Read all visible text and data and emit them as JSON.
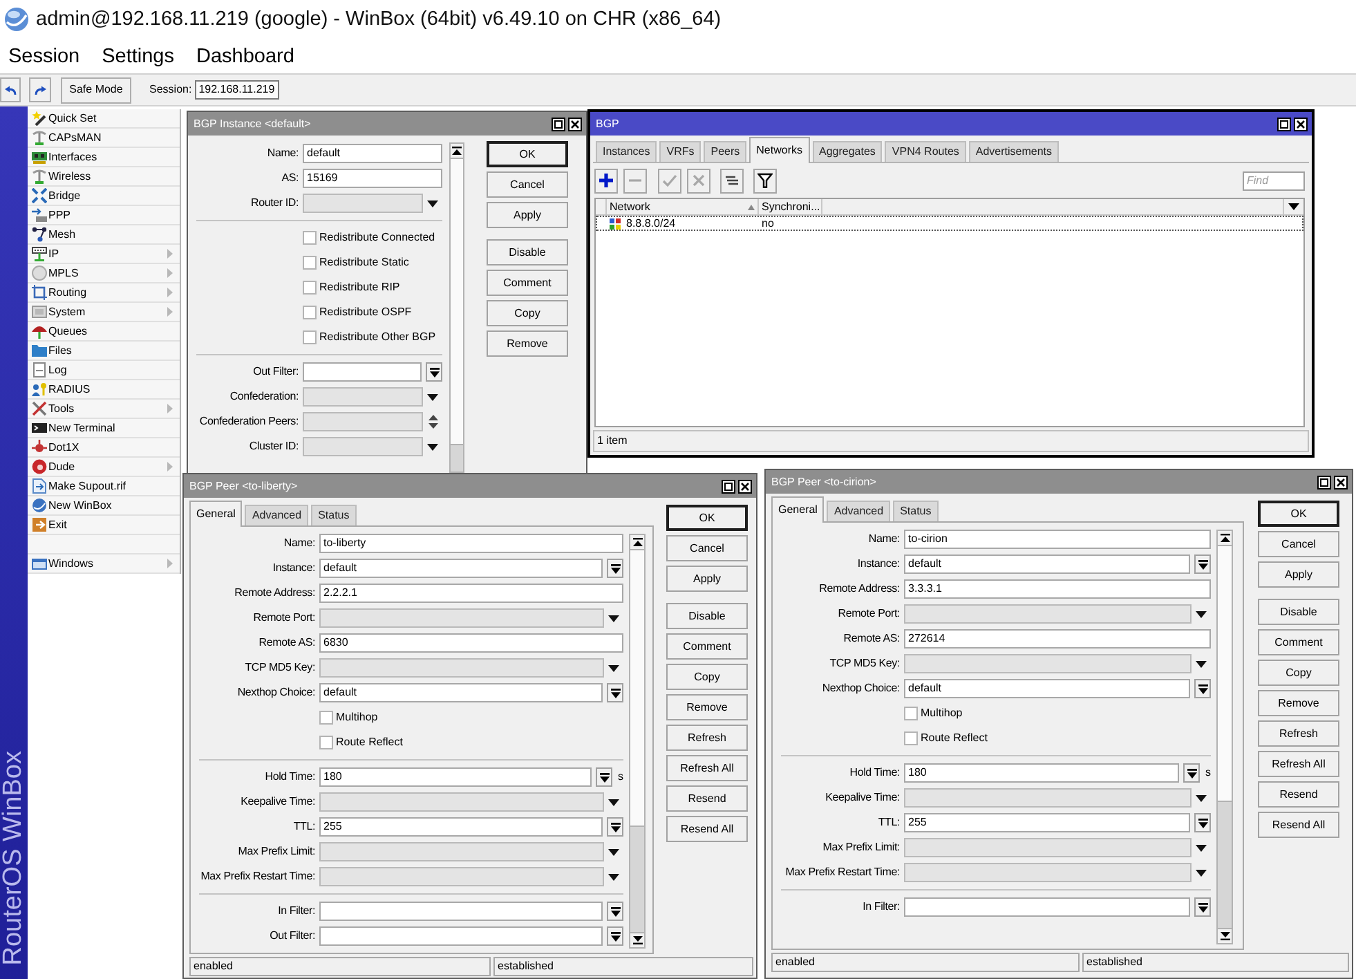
{
  "window": {
    "title": "admin@192.168.11.219 (google) - WinBox (64bit) v6.49.10 on CHR (x86_64)"
  },
  "menu_bar": [
    "Session",
    "Settings",
    "Dashboard"
  ],
  "toolbar": {
    "safe_mode": {
      "label": "Safe Mode",
      "on": false
    },
    "session_label": "Session:",
    "session_value": "192.168.11.219"
  },
  "sidebar": {
    "brand": "RouterOS WinBox",
    "items": [
      {
        "label": "Quick Set",
        "submenu": false
      },
      {
        "label": "CAPsMAN",
        "submenu": false
      },
      {
        "label": "Interfaces",
        "submenu": false
      },
      {
        "label": "Wireless",
        "submenu": false
      },
      {
        "label": "Bridge",
        "submenu": false
      },
      {
        "label": "PPP",
        "submenu": false
      },
      {
        "label": "Mesh",
        "submenu": false
      },
      {
        "label": "IP",
        "submenu": true
      },
      {
        "label": "MPLS",
        "submenu": true
      },
      {
        "label": "Routing",
        "submenu": true
      },
      {
        "label": "System",
        "submenu": true
      },
      {
        "label": "Queues",
        "submenu": false
      },
      {
        "label": "Files",
        "submenu": false
      },
      {
        "label": "Log",
        "submenu": false
      },
      {
        "label": "RADIUS",
        "submenu": false
      },
      {
        "label": "Tools",
        "submenu": true
      },
      {
        "label": "New Terminal",
        "submenu": false
      },
      {
        "label": "Dot1X",
        "submenu": false
      },
      {
        "label": "Dude",
        "submenu": true
      },
      {
        "label": "Make Supout.rif",
        "submenu": false
      },
      {
        "label": "New WinBox",
        "submenu": false
      },
      {
        "label": "Exit",
        "submenu": false
      }
    ],
    "footer_items": [
      {
        "label": "Windows",
        "submenu": true
      }
    ]
  },
  "windows": [
    {
      "kind": "form",
      "title": "BGP Instance <default>",
      "active": false,
      "form": [
        {
          "kind": "text",
          "label": "Name:",
          "value": "default"
        },
        {
          "kind": "text",
          "label": "AS:",
          "value": "15169"
        },
        {
          "kind": "unset",
          "label": "Router ID:"
        },
        {
          "kind": "separator"
        },
        {
          "kind": "checkbox",
          "label": "Redistribute Connected",
          "checked": false
        },
        {
          "kind": "checkbox",
          "label": "Redistribute Static",
          "checked": false
        },
        {
          "kind": "checkbox",
          "label": "Redistribute RIP",
          "checked": false
        },
        {
          "kind": "checkbox",
          "label": "Redistribute OSPF",
          "checked": false
        },
        {
          "kind": "checkbox",
          "label": "Redistribute Other BGP",
          "checked": false
        },
        {
          "kind": "separator"
        },
        {
          "kind": "dropdown",
          "label": "Out Filter:"
        },
        {
          "kind": "unset",
          "label": "Confederation:"
        },
        {
          "kind": "spinner",
          "label": "Confederation Peers:"
        },
        {
          "kind": "unset",
          "label": "Cluster ID:"
        }
      ],
      "button_groups": [
        [
          {
            "label": "OK",
            "default": true
          },
          {
            "label": "Cancel",
            "default": false
          },
          {
            "label": "Apply",
            "default": false
          }
        ],
        [
          {
            "label": "Disable",
            "default": false
          },
          {
            "label": "Comment",
            "default": false
          },
          {
            "label": "Copy",
            "default": false
          },
          {
            "label": "Remove",
            "default": false
          }
        ]
      ]
    },
    {
      "kind": "list",
      "title": "BGP",
      "active": true,
      "tabs": [
        {
          "label": "Instances",
          "selected": false
        },
        {
          "label": "VRFs",
          "selected": false
        },
        {
          "label": "Peers",
          "selected": false
        },
        {
          "label": "Networks",
          "selected": true
        },
        {
          "label": "Aggregates",
          "selected": false
        },
        {
          "label": "VPN4 Routes",
          "selected": false
        },
        {
          "label": "Advertisements",
          "selected": false
        }
      ],
      "toolbar": [
        {
          "kind": "add",
          "disabled": false
        },
        {
          "kind": "remove",
          "disabled": true
        },
        {
          "kind": "enable",
          "disabled": true
        },
        {
          "kind": "disable",
          "disabled": true
        },
        {
          "kind": "comment",
          "disabled": false
        },
        {
          "kind": "filter",
          "disabled": false
        }
      ],
      "find": {
        "placeholder": "Find"
      },
      "table": {
        "columns": [
          {
            "label": "Network",
            "sorted": true
          },
          {
            "label": "Synchroni...",
            "sorted": false
          }
        ],
        "rows": [
          {
            "cells": [
              "8.8.8.0/24",
              "no"
            ],
            "selected": false,
            "focused": true
          }
        ]
      },
      "status_bar": "1 item"
    },
    {
      "kind": "form",
      "title": "BGP Peer <to-liberty>",
      "active": false,
      "tabs": [
        {
          "label": "General",
          "selected": true
        },
        {
          "label": "Advanced",
          "selected": false
        },
        {
          "label": "Status",
          "selected": false
        }
      ],
      "form": [
        {
          "kind": "text",
          "label": "Name:",
          "value": "to-liberty"
        },
        {
          "kind": "dropdown",
          "label": "Instance:",
          "value": "default"
        },
        {
          "kind": "text",
          "label": "Remote Address:",
          "value": "2.2.2.1"
        },
        {
          "kind": "unset",
          "label": "Remote Port:"
        },
        {
          "kind": "text",
          "label": "Remote AS:",
          "value": "6830"
        },
        {
          "kind": "unset",
          "label": "TCP MD5 Key:"
        },
        {
          "kind": "dropdown",
          "label": "Nexthop Choice:",
          "value": "default"
        },
        {
          "kind": "checkbox",
          "label": "Multihop",
          "checked": false
        },
        {
          "kind": "checkbox",
          "label": "Route Reflect",
          "checked": false
        },
        {
          "kind": "separator"
        },
        {
          "kind": "dropdown",
          "label": "Hold Time:",
          "value": "180",
          "unit": "s"
        },
        {
          "kind": "unset",
          "label": "Keepalive Time:"
        },
        {
          "kind": "dropdown",
          "label": "TTL:",
          "value": "255"
        },
        {
          "kind": "unset",
          "label": "Max Prefix Limit:"
        },
        {
          "kind": "unset",
          "label": "Max Prefix Restart Time:"
        },
        {
          "kind": "separator"
        },
        {
          "kind": "dropdown",
          "label": "In Filter:"
        },
        {
          "kind": "dropdown",
          "label": "Out Filter:"
        }
      ],
      "button_groups": [
        [
          {
            "label": "OK",
            "default": true
          },
          {
            "label": "Cancel",
            "default": false
          },
          {
            "label": "Apply",
            "default": false
          }
        ],
        [
          {
            "label": "Disable",
            "default": false
          },
          {
            "label": "Comment",
            "default": false
          },
          {
            "label": "Copy",
            "default": false
          },
          {
            "label": "Remove",
            "default": false
          },
          {
            "label": "Refresh",
            "default": false
          },
          {
            "label": "Refresh All",
            "default": false
          },
          {
            "label": "Resend",
            "default": false
          },
          {
            "label": "Resend All",
            "default": false
          }
        ]
      ],
      "status_bar": [
        "enabled",
        "established"
      ]
    },
    {
      "kind": "form",
      "title": "BGP Peer <to-cirion>",
      "active": false,
      "tabs": [
        {
          "label": "General",
          "selected": true
        },
        {
          "label": "Advanced",
          "selected": false
        },
        {
          "label": "Status",
          "selected": false
        }
      ],
      "form": [
        {
          "kind": "text",
          "label": "Name:",
          "value": "to-cirion"
        },
        {
          "kind": "dropdown",
          "label": "Instance:",
          "value": "default"
        },
        {
          "kind": "text",
          "label": "Remote Address:",
          "value": "3.3.3.1"
        },
        {
          "kind": "unset",
          "label": "Remote Port:"
        },
        {
          "kind": "text",
          "label": "Remote AS:",
          "value": "272614"
        },
        {
          "kind": "unset",
          "label": "TCP MD5 Key:"
        },
        {
          "kind": "dropdown",
          "label": "Nexthop Choice:",
          "value": "default"
        },
        {
          "kind": "checkbox",
          "label": "Multihop",
          "checked": false
        },
        {
          "kind": "checkbox",
          "label": "Route Reflect",
          "checked": false
        },
        {
          "kind": "separator"
        },
        {
          "kind": "dropdown",
          "label": "Hold Time:",
          "value": "180",
          "unit": "s"
        },
        {
          "kind": "unset",
          "label": "Keepalive Time:"
        },
        {
          "kind": "dropdown",
          "label": "TTL:",
          "value": "255"
        },
        {
          "kind": "unset",
          "label": "Max Prefix Limit:"
        },
        {
          "kind": "unset",
          "label": "Max Prefix Restart Time:"
        },
        {
          "kind": "separator"
        },
        {
          "kind": "dropdown",
          "label": "In Filter:"
        }
      ],
      "button_groups": [
        [
          {
            "label": "OK",
            "default": true
          },
          {
            "label": "Cancel",
            "default": false
          },
          {
            "label": "Apply",
            "default": false
          }
        ],
        [
          {
            "label": "Disable",
            "default": false
          },
          {
            "label": "Comment",
            "default": false
          },
          {
            "label": "Copy",
            "default": false
          },
          {
            "label": "Remove",
            "default": false
          },
          {
            "label": "Refresh",
            "default": false
          },
          {
            "label": "Refresh All",
            "default": false
          },
          {
            "label": "Resend",
            "default": false
          },
          {
            "label": "Resend All",
            "default": false
          }
        ]
      ],
      "status_bar": [
        "enabled",
        "established"
      ]
    }
  ]
}
